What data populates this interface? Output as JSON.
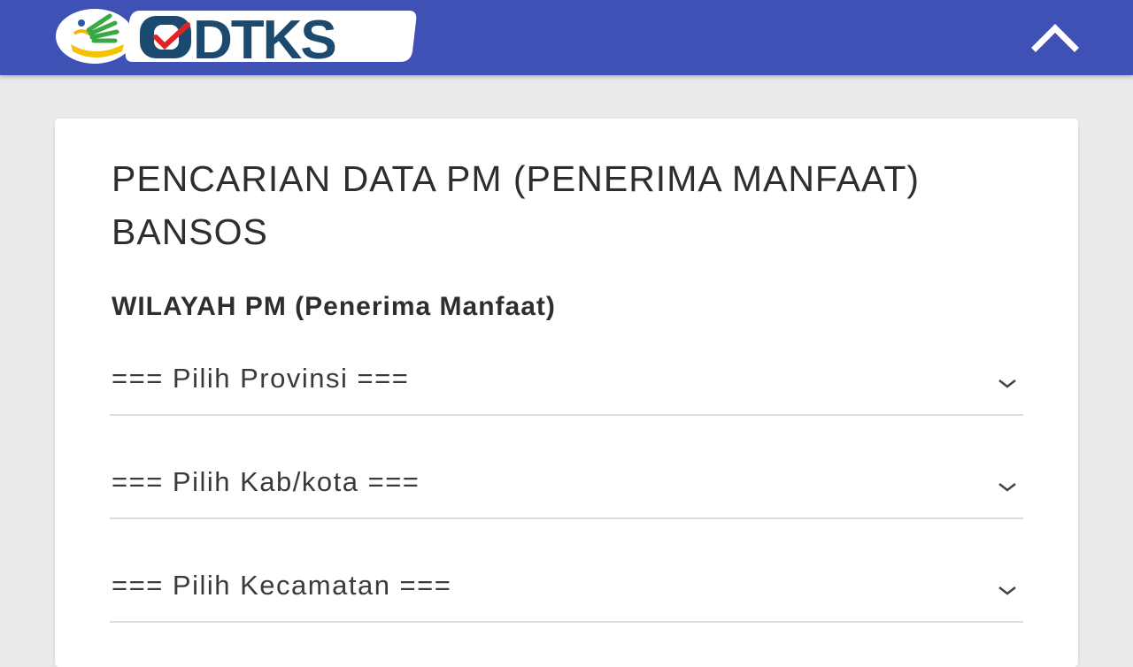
{
  "header": {
    "logo_text": "DTKS",
    "brand_color": "#3f51b5",
    "collapse_icon": "chevron-up-icon"
  },
  "search": {
    "title": "PENCARIAN DATA PM (PENERIMA MANFAAT) BANSOS",
    "section_label": "WILAYAH PM (Penerima Manfaat)",
    "dropdowns": [
      {
        "name": "provinsi",
        "selected": "=== Pilih Provinsi ==="
      },
      {
        "name": "kabkota",
        "selected": "=== Pilih Kab/kota ==="
      },
      {
        "name": "kecamatan",
        "selected": "=== Pilih Kecamatan ==="
      }
    ]
  }
}
